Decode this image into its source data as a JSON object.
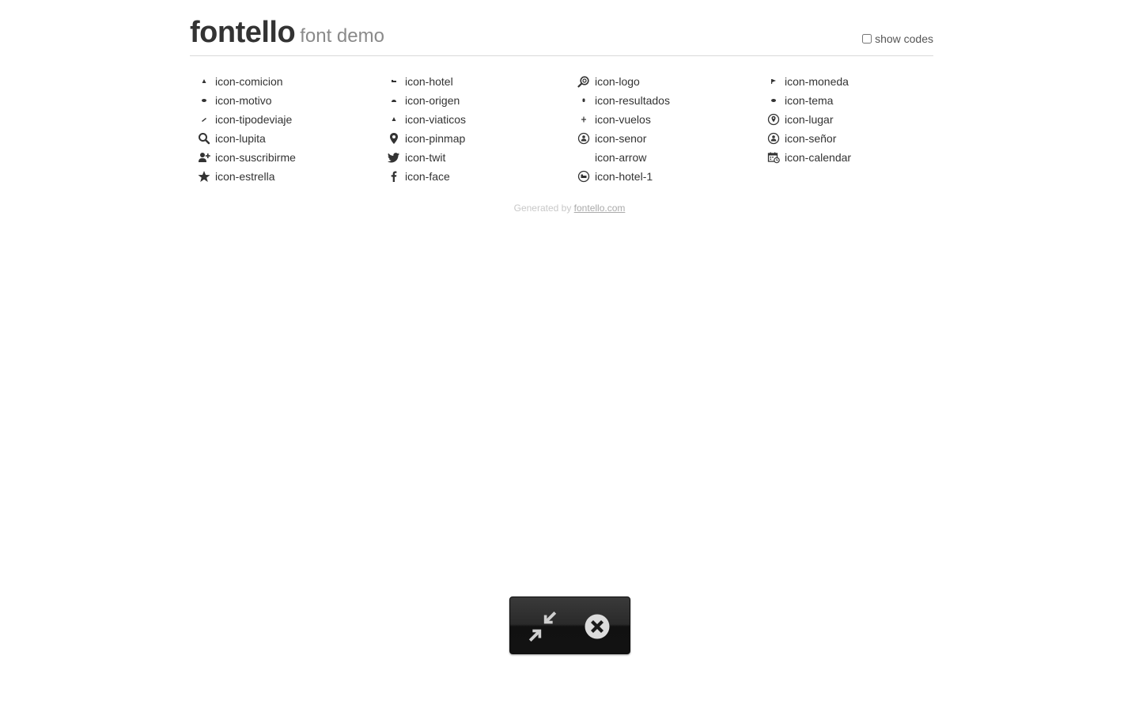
{
  "header": {
    "title": "fontello",
    "subtitle": "font demo",
    "show_codes_label": "show codes",
    "show_codes_checked": false
  },
  "icons": [
    {
      "label": "icon-comicion",
      "icon": "small-triangle-icon"
    },
    {
      "label": "icon-motivo",
      "icon": "small-oval-icon"
    },
    {
      "label": "icon-tipodeviaje",
      "icon": "small-slash-icon"
    },
    {
      "label": "icon-lupita",
      "icon": "search-icon"
    },
    {
      "label": "icon-suscribirme",
      "icon": "user-add-icon"
    },
    {
      "label": "icon-estrella",
      "icon": "star-icon"
    },
    {
      "label": "icon-hotel",
      "icon": "small-bed-icon"
    },
    {
      "label": "icon-origen",
      "icon": "small-dome-icon"
    },
    {
      "label": "icon-viaticos",
      "icon": "small-triangle-icon"
    },
    {
      "label": "icon-pinmap",
      "icon": "map-pin-icon"
    },
    {
      "label": "icon-twit",
      "icon": "twitter-icon"
    },
    {
      "label": "icon-face",
      "icon": "facebook-icon"
    },
    {
      "label": "icon-logo",
      "icon": "logo-search-icon"
    },
    {
      "label": "icon-resultados",
      "icon": "small-dot-icon"
    },
    {
      "label": "icon-vuelos",
      "icon": "small-plane-icon"
    },
    {
      "label": "icon-senor",
      "icon": "person-circle-icon"
    },
    {
      "label": "icon-arrow",
      "icon": "blank-icon"
    },
    {
      "label": "icon-hotel-1",
      "icon": "hotel-circle-icon"
    },
    {
      "label": "icon-moneda",
      "icon": "small-flag-icon"
    },
    {
      "label": "icon-tema",
      "icon": "small-oval-icon"
    },
    {
      "label": "icon-lugar",
      "icon": "location-circle-icon"
    },
    {
      "label": "icon-señor",
      "icon": "person-circle-icon"
    },
    {
      "label": "icon-calendar",
      "icon": "calendar-icon"
    }
  ],
  "footer": {
    "prefix": "Generated by",
    "link_text": "fontello.com"
  },
  "overlay": {
    "exit_fullscreen_icon": "exit-fullscreen-icon",
    "close_icon": "close-circle-icon"
  }
}
